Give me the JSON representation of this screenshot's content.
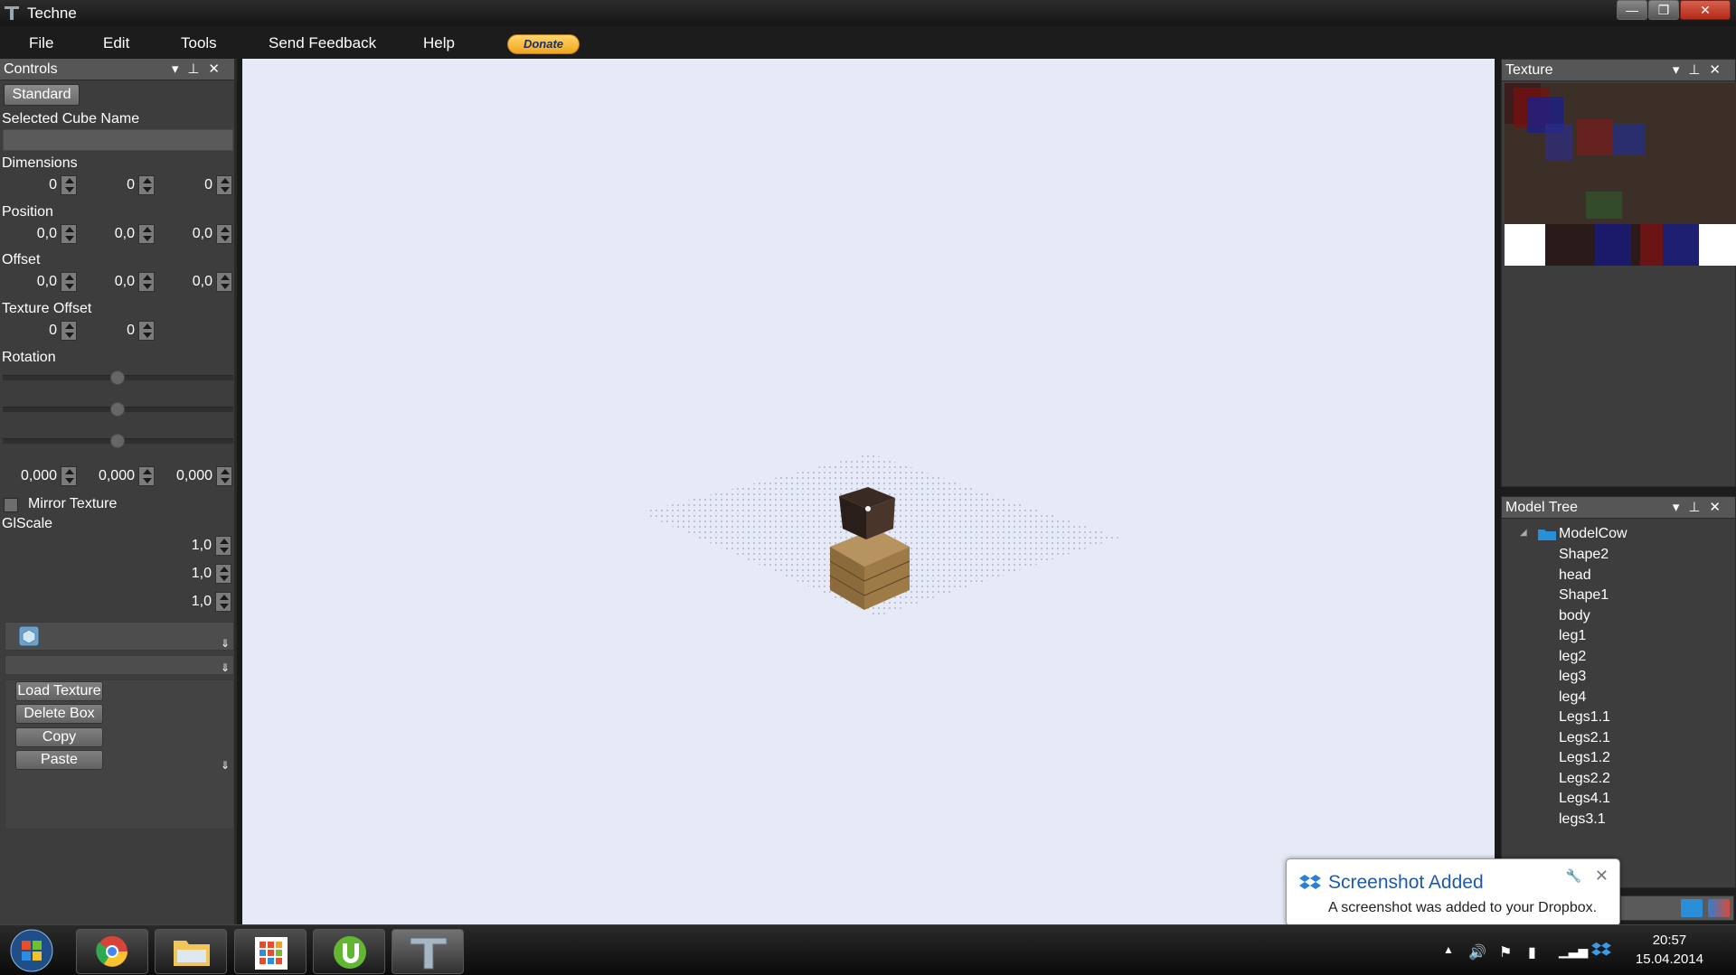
{
  "window": {
    "title": "Techne",
    "min_label": "—",
    "max_label": "❐",
    "close_label": "✕"
  },
  "menu": {
    "file": "File",
    "edit": "Edit",
    "tools": "Tools",
    "feedback": "Send Feedback",
    "help": "Help",
    "donate": "Donate"
  },
  "controls": {
    "title": "Controls",
    "standard": "Standard",
    "selected_cube_name": "Selected Cube Name",
    "dimensions_label": "Dimensions",
    "dimensions": [
      "0",
      "0",
      "0"
    ],
    "position_label": "Position",
    "position": [
      "0,0",
      "0,0",
      "0,0"
    ],
    "offset_label": "Offset",
    "offset": [
      "0,0",
      "0,0",
      "0,0"
    ],
    "texture_offset_label": "Texture Offset",
    "texture_offset": [
      "0",
      "0"
    ],
    "rotation_label": "Rotation",
    "rotation": [
      "0,000",
      "0,000",
      "0,000"
    ],
    "mirror_texture": "Mirror Texture",
    "glscale_label": "GlScale",
    "glscale": [
      "1,0",
      "1,0",
      "1,0"
    ],
    "buttons": {
      "load_texture": "Load Texture",
      "delete_box": "Delete Box",
      "copy": "Copy",
      "paste": "Paste"
    }
  },
  "texture_panel": {
    "title": "Texture"
  },
  "model_tree": {
    "title": "Model Tree",
    "root": "ModelCow",
    "items": [
      "Shape2",
      "head",
      "Shape1",
      "body",
      "leg1",
      "leg2",
      "leg3",
      "leg4",
      "Legs1.1",
      "Legs2.1",
      "Legs1.2",
      "Legs2.2",
      "Legs4.1",
      "legs3.1"
    ]
  },
  "notification": {
    "title": "Screenshot Added",
    "body": "A screenshot was added to your Dropbox."
  },
  "taskbar": {
    "time": "20:57",
    "date": "15.04.2014"
  },
  "icons": [
    "app-icon",
    "start-orb-icon",
    "chrome-icon",
    "explorer-icon",
    "metro-apps-icon",
    "utorrent-icon",
    "techne-icon",
    "dropbox-icon",
    "volume-icon",
    "flag-icon",
    "network-icon"
  ]
}
